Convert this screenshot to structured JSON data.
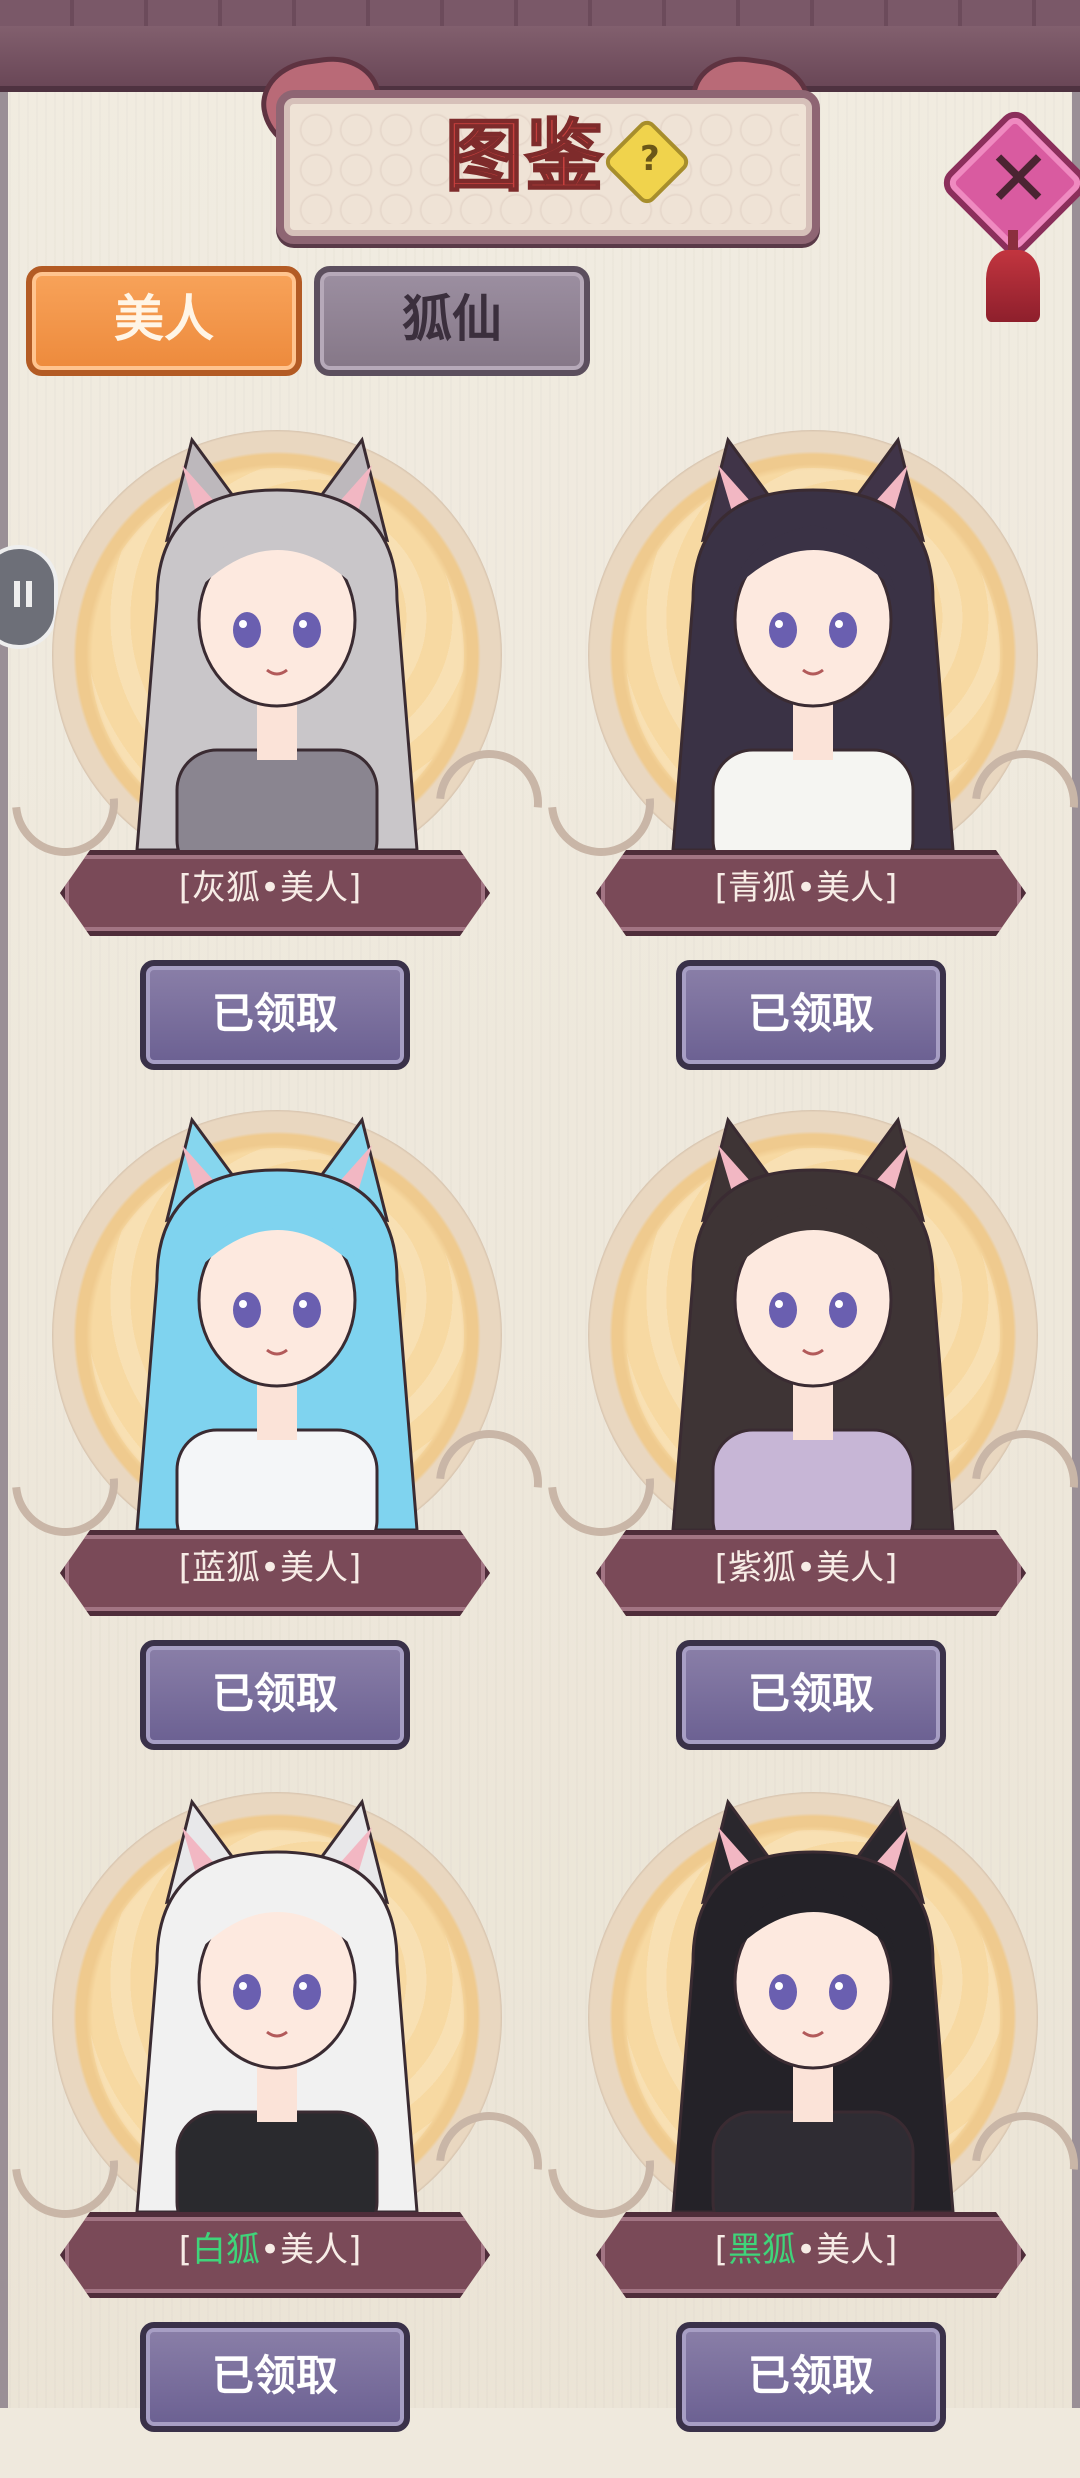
{
  "header": {
    "title": "图鉴",
    "help_icon_text": "?",
    "close_icon_text": "✕"
  },
  "tabs": [
    {
      "label": "美人",
      "active": true
    },
    {
      "label": "狐仙",
      "active": false
    }
  ],
  "cards": [
    {
      "name_prefix": "[",
      "name_main": "灰狐",
      "name_suffix": "•美人]",
      "highlight": false,
      "button": "已领取",
      "hair": "#c9c6c9",
      "outfit": "#8a8590",
      "ear": "#bdb8bc"
    },
    {
      "name_prefix": "[",
      "name_main": "青狐",
      "name_suffix": "•美人]",
      "highlight": false,
      "button": "已领取",
      "hair": "#3a3245",
      "outfit": "#f5f5f2",
      "ear": "#403448"
    },
    {
      "name_prefix": "[",
      "name_main": "蓝狐",
      "name_suffix": "•美人]",
      "highlight": false,
      "button": "已领取",
      "hair": "#7fd3ef",
      "outfit": "#f4f6f8",
      "ear": "#86d6ee"
    },
    {
      "name_prefix": "[",
      "name_main": "紫狐",
      "name_suffix": "•美人]",
      "highlight": false,
      "button": "已领取",
      "hair": "#3e3435",
      "outfit": "#c7b6d6",
      "ear": "#3e3435"
    },
    {
      "name_prefix": "[",
      "name_main": "白狐",
      "name_suffix": "•美人]",
      "highlight": true,
      "button": "已领取",
      "hair": "#f1f1f1",
      "outfit": "#2a2a2e",
      "ear": "#e8e8ea"
    },
    {
      "name_prefix": "[",
      "name_main": "黑狐",
      "name_suffix": "•美人]",
      "highlight": true,
      "button": "已领取",
      "hair": "#242228",
      "outfit": "#2f2c33",
      "ear": "#2a272d"
    }
  ],
  "colors": {
    "accent_orange": "#ee8c3f",
    "banner": "#7a4a58",
    "button_purple": "#75699b",
    "highlight_green": "#3fd57a"
  }
}
